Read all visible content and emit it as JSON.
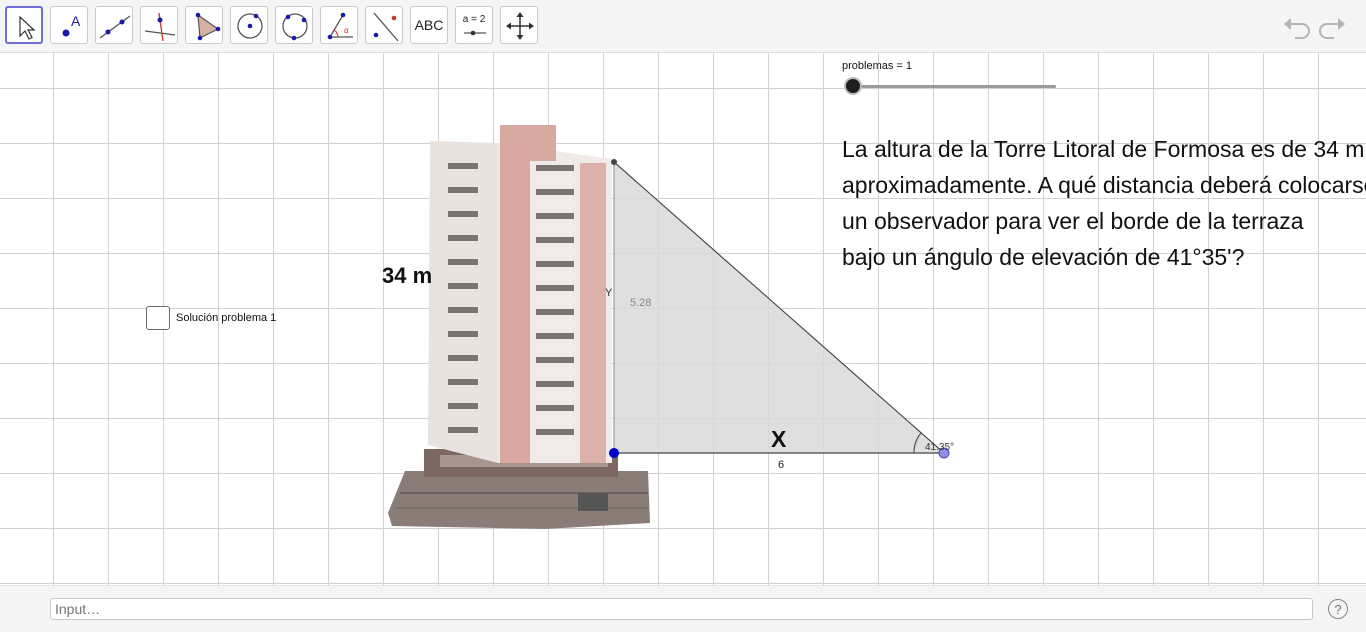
{
  "toolbar": {
    "tools": [
      {
        "icon": "move-pointer-icon"
      },
      {
        "icon": "point-icon",
        "glyph": "A"
      },
      {
        "icon": "line-icon"
      },
      {
        "icon": "perpendicular-line-icon"
      },
      {
        "icon": "polygon-icon"
      },
      {
        "icon": "circle-center-point-icon"
      },
      {
        "icon": "circle-three-points-icon"
      },
      {
        "icon": "angle-icon"
      },
      {
        "icon": "reflect-about-line-icon"
      },
      {
        "icon": "text-icon",
        "label": "ABC"
      },
      {
        "icon": "slider-icon",
        "label": "a = 2"
      },
      {
        "icon": "move-graphics-view-icon"
      }
    ],
    "undo_icon": "undo-icon",
    "redo_icon": "redo-icon"
  },
  "slider": {
    "label": "problemas = 1",
    "value": 1
  },
  "problem": {
    "text": "La altura de la Torre Litoral de Formosa es de 34 m\naproximadamente. A qué distancia deberá colocarse\nun observador para ver el borde de la terraza\nbajo un ángulo de elevación de 41°35'?"
  },
  "checkbox": {
    "label": "Solución problema 1",
    "checked": false
  },
  "figure": {
    "height_label": "34 m",
    "vertical_point_label": "Y",
    "vertical_length": "5.28",
    "base_label": "X",
    "base_length": "6",
    "angle_label": "41.35°"
  },
  "colors": {
    "triangle_fill": "#d9d9d9",
    "point_blue": "#0000cc",
    "point_lilac": "#8f8fe8"
  },
  "input": {
    "placeholder": "Input…",
    "value": ""
  },
  "help_icon": "help-icon"
}
